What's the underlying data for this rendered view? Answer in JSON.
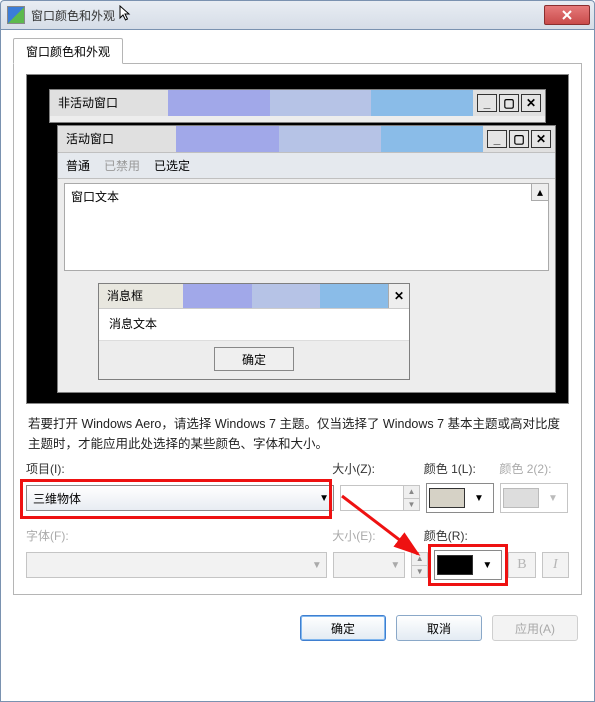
{
  "title": "窗口颜色和外观",
  "tab": "窗口颜色和外观",
  "preview": {
    "inactive_window": "非活动窗口",
    "active_window": "活动窗口",
    "menu_normal": "普通",
    "menu_disabled": "已禁用",
    "menu_selected": "已选定",
    "window_text": "窗口文本",
    "message_box": "消息框",
    "message_text": "消息文本",
    "ok": "确定"
  },
  "description": "若要打开 Windows Aero，请选择 Windows 7 主题。仅当选择了 Windows 7 基本主题或高对比度主题时，才能应用此处选择的某些颜色、字体和大小。",
  "labels": {
    "item": "项目(I):",
    "size1": "大小(Z):",
    "color1": "颜色 1(L):",
    "color2": "颜色 2(2):",
    "font": "字体(F):",
    "size2": "大小(E):",
    "colorR": "颜色(R):"
  },
  "item_value": "三维物体",
  "color1_swatch": "#d6d2c6",
  "colorR_swatch": "#000000",
  "bold_label": "B",
  "italic_label": "I",
  "buttons": {
    "ok": "确定",
    "cancel": "取消",
    "apply": "应用(A)"
  }
}
